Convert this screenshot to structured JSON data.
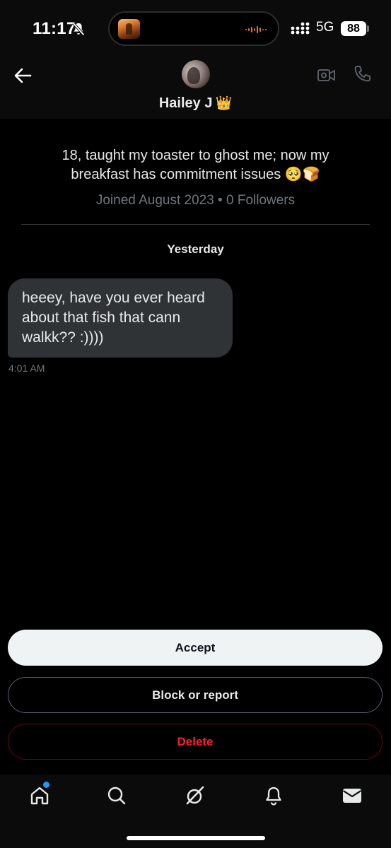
{
  "status_bar": {
    "time": "11:17",
    "network": "5G",
    "battery": "88"
  },
  "header": {
    "name": "Hailey J",
    "badge_emoji": "👑",
    "back_icon": "arrow-left-icon",
    "video_icon": "video-camera-icon",
    "call_icon": "phone-icon"
  },
  "profile": {
    "bio": "18, taught my toaster to ghost me; now my breakfast has commitment issues 🥺🍞",
    "joined_row": "Joined August 2023 • 0 Followers"
  },
  "conversation": {
    "day_label": "Yesterday",
    "messages": [
      {
        "text": "heeey, have you ever heard about that fish that cann walkk?? :))))",
        "time": "4:01 AM"
      }
    ]
  },
  "actions": {
    "accept": "Accept",
    "block_or_report": "Block or report",
    "delete": "Delete"
  },
  "bottom_nav": {
    "items": [
      "home-icon",
      "search-icon",
      "grok-icon",
      "bell-icon",
      "mail-icon"
    ]
  },
  "colors": {
    "accent": "#1d9bf0",
    "danger": "#f4212e",
    "bubble": "#2f3336",
    "muted_text": "#71767b"
  }
}
